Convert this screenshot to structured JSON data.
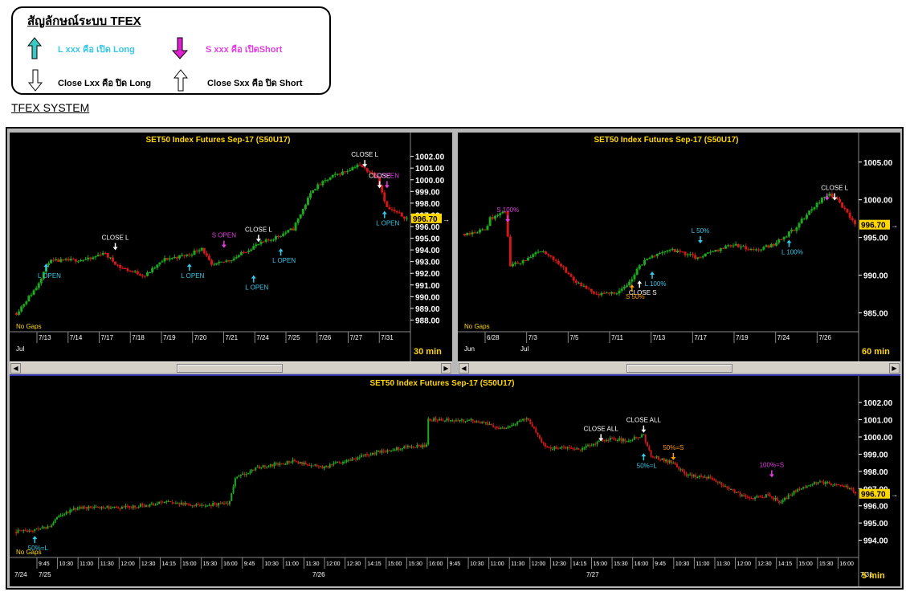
{
  "legend": {
    "title": "สัญลักษณ์ระบบ TFEX",
    "long_open": "L xxx คือ เปิด Long",
    "short_open": "S xxx คือ เปิดShort",
    "long_close": "Close Lxx คือ ปิด Long",
    "short_close": "Close Sxx คือ ปิด Short",
    "icons": [
      "arrow-up-teal-icon",
      "arrow-down-magenta-icon",
      "arrow-down-outline-icon",
      "arrow-up-outline-icon"
    ]
  },
  "system_title": "TFEX SYSTEM",
  "colors": {
    "up": "#1ea81e",
    "down": "#d01818",
    "title": "#ffd700",
    "axis": "#ffffff",
    "long": "#35c8e8",
    "short": "#e040e0",
    "close": "#ffffff",
    "half": "#ff9900",
    "cur": "#ffd700"
  },
  "chart_data": [
    {
      "type": "candlestick",
      "title": "SET50  Index  Futures  Sep-17  (S50U17)",
      "timeframe": "30  min",
      "gaps_label": "No Gaps",
      "ylim": [
        987.0,
        1002.8
      ],
      "yticks": [
        "1002.00",
        "1001.00",
        "1000.00",
        "999.00",
        "998.00",
        "997.00",
        "996.00",
        "995.00",
        "994.00",
        "993.00",
        "992.00",
        "991.00",
        "990.00",
        "989.00",
        "988.00"
      ],
      "current_price": "996.70",
      "x_labels": [
        "7/13",
        "7/14",
        "7/17",
        "7/18",
        "7/19",
        "7/20",
        "7/21",
        "7/24",
        "7/25",
        "7/26",
        "7/27",
        "7/31"
      ],
      "x_sub_labels": [
        "Jul"
      ],
      "anchors": [
        [
          0,
          988.6
        ],
        [
          8,
          990.8
        ],
        [
          13,
          993.0
        ],
        [
          30,
          993.2
        ],
        [
          35,
          993.8
        ],
        [
          42,
          992.5
        ],
        [
          52,
          991.8
        ],
        [
          60,
          993.2
        ],
        [
          70,
          993.6
        ],
        [
          75,
          994.2
        ],
        [
          79,
          992.6
        ],
        [
          88,
          993.3
        ],
        [
          96,
          994.3
        ],
        [
          104,
          995.0
        ],
        [
          112,
          995.8
        ],
        [
          120,
          999.2
        ],
        [
          128,
          1000.3
        ],
        [
          134,
          1000.8
        ],
        [
          138,
          1001.3
        ],
        [
          146,
          1000.3
        ],
        [
          150,
          997.6
        ],
        [
          158,
          996.7
        ]
      ],
      "signals": [
        {
          "text": "L  OPEN",
          "kind": "long",
          "x": 12,
          "price": 992.9,
          "pos": "below"
        },
        {
          "text": "CLOSE  L",
          "kind": "close",
          "x": 40,
          "price": 993.9,
          "pos": "above"
        },
        {
          "text": "L  OPEN",
          "kind": "long",
          "x": 70,
          "price": 992.9,
          "pos": "below"
        },
        {
          "text": "S  OPEN",
          "kind": "short",
          "x": 84,
          "price": 994.1,
          "pos": "above"
        },
        {
          "text": "CLOSE  L",
          "kind": "close",
          "x": 98,
          "price": 994.6,
          "pos": "above"
        },
        {
          "text": "L  OPEN",
          "kind": "long",
          "x": 96,
          "price": 991.9,
          "pos": "below"
        },
        {
          "text": "L  OPEN",
          "kind": "long",
          "x": 107,
          "price": 994.2,
          "pos": "below"
        },
        {
          "text": "CLOSE  L",
          "kind": "close",
          "x": 141,
          "price": 1001.0,
          "pos": "above"
        },
        {
          "text": "CLOSE",
          "kind": "close",
          "x": 147,
          "price": 999.2,
          "pos": "above"
        },
        {
          "text": "S  OPEN",
          "kind": "short",
          "x": 150,
          "price": 999.2,
          "pos": "above"
        },
        {
          "text": "L  OPEN",
          "kind": "long",
          "x": 149,
          "price": 997.4,
          "pos": "below"
        }
      ]
    },
    {
      "type": "candlestick",
      "title": "SET50  Index  Futures  Sep-17  (S50U17)",
      "timeframe": "60  min",
      "gaps_label": "No Gaps",
      "ylim": [
        982.5,
        1007.0
      ],
      "yticks": [
        "1005.00",
        "1000.00",
        "995.00",
        "990.00",
        "985.00"
      ],
      "current_price": "996.70",
      "x_labels": [
        "6/28",
        "7/3",
        "7/5",
        "7/11",
        "7/13",
        "7/17",
        "7/19",
        "7/24",
        "7/26"
      ],
      "x_sub_labels": [
        "Jun",
        "Jul"
      ],
      "anchors": [
        [
          0,
          995.5
        ],
        [
          8,
          996.0
        ],
        [
          10,
          997.5
        ],
        [
          16,
          998.5
        ],
        [
          18,
          991.3
        ],
        [
          24,
          992.0
        ],
        [
          30,
          993.2
        ],
        [
          36,
          992.0
        ],
        [
          44,
          989.0
        ],
        [
          52,
          987.3
        ],
        [
          60,
          987.8
        ],
        [
          64,
          988.5
        ],
        [
          68,
          990.8
        ],
        [
          72,
          992.2
        ],
        [
          80,
          993.4
        ],
        [
          86,
          993.0
        ],
        [
          92,
          992.2
        ],
        [
          98,
          993.2
        ],
        [
          106,
          994.1
        ],
        [
          114,
          993.2
        ],
        [
          122,
          994.1
        ],
        [
          130,
          996.1
        ],
        [
          138,
          999.2
        ],
        [
          144,
          1000.9
        ],
        [
          148,
          999.5
        ],
        [
          154,
          996.7
        ]
      ],
      "signals": [
        {
          "text": "S  100%",
          "kind": "short",
          "x": 17,
          "price": 996.9,
          "pos": "above"
        },
        {
          "text": "CLOSE  S",
          "kind": "close",
          "x": 69,
          "price": 989.4,
          "pos": "below"
        },
        {
          "text": "S  50%",
          "kind": "half",
          "x": 66,
          "price": 988.9,
          "pos": "below"
        },
        {
          "text": "L  100%",
          "kind": "long",
          "x": 74,
          "price": 990.6,
          "pos": "below"
        },
        {
          "text": "L  50%",
          "kind": "long",
          "x": 93,
          "price": 994.1,
          "pos": "above"
        },
        {
          "text": "L  100%",
          "kind": "long",
          "x": 128,
          "price": 994.8,
          "pos": "below"
        },
        {
          "text": "CLOSE  L",
          "kind": "close",
          "x": 146,
          "price": 999.8,
          "pos": "above"
        },
        {
          "text": "",
          "kind": "short",
          "x": 143,
          "price": 999.8,
          "pos": "above"
        }
      ]
    },
    {
      "type": "candlestick",
      "title": "SET50  Index  Futures  Sep-17  (S50U17)",
      "timeframe": "5  min",
      "gaps_label": "No Gaps",
      "ylim": [
        993.0,
        1002.8
      ],
      "yticks": [
        "1002.00",
        "1001.00",
        "1000.00",
        "999.00",
        "998.00",
        "997.00",
        "996.00",
        "995.00",
        "994.00"
      ],
      "current_price": "996.70",
      "x_labels": [
        "9:45",
        "10:30",
        "11:00",
        "11:30",
        "12:00",
        "12:30",
        "14:15",
        "15:00",
        "15:30",
        "16:00",
        "9:45",
        "10:30",
        "11:00",
        "11:30",
        "12:00",
        "12:30",
        "14:15",
        "15:00",
        "15:30",
        "16:00",
        "9:45",
        "10:30",
        "11:00",
        "11:30",
        "12:00",
        "12:30",
        "14:15",
        "15:00",
        "15:30",
        "16:00",
        "9:45",
        "10:30",
        "11:00",
        "11:30",
        "12:00",
        "12:30",
        "14:15",
        "15:00",
        "15:30",
        "16:00"
      ],
      "x_sub_labels": [
        "7/24",
        "7/25",
        "7/26",
        "7/27",
        "7/31"
      ],
      "anchors": [
        [
          0,
          994.5
        ],
        [
          10,
          994.6
        ],
        [
          18,
          994.8
        ],
        [
          24,
          995.5
        ],
        [
          34,
          995.9
        ],
        [
          60,
          995.9
        ],
        [
          80,
          996.2
        ],
        [
          100,
          996.0
        ],
        [
          115,
          996.2
        ],
        [
          118,
          997.6
        ],
        [
          130,
          998.2
        ],
        [
          150,
          998.6
        ],
        [
          165,
          998.2
        ],
        [
          190,
          999.0
        ],
        [
          210,
          999.4
        ],
        [
          221,
          999.5
        ],
        [
          222,
          1001.0
        ],
        [
          245,
          1001.0
        ],
        [
          262,
          1000.5
        ],
        [
          275,
          1001.1
        ],
        [
          285,
          999.4
        ],
        [
          305,
          999.3
        ],
        [
          318,
          999.9
        ],
        [
          330,
          999.8
        ],
        [
          338,
          1000.1
        ],
        [
          342,
          998.9
        ],
        [
          354,
          998.5
        ],
        [
          360,
          997.8
        ],
        [
          375,
          997.6
        ],
        [
          385,
          996.9
        ],
        [
          395,
          996.4
        ],
        [
          405,
          996.6
        ],
        [
          412,
          996.2
        ],
        [
          420,
          996.9
        ],
        [
          430,
          997.4
        ],
        [
          445,
          997.2
        ],
        [
          452,
          996.8
        ]
      ],
      "signals": [
        {
          "text": "50%=L",
          "kind": "long",
          "x": 10,
          "price": 994.3,
          "pos": "below"
        },
        {
          "text": "CLOSE  ALL",
          "kind": "close",
          "x": 315,
          "price": 999.7,
          "pos": "above"
        },
        {
          "text": "CLOSE  ALL",
          "kind": "close",
          "x": 338,
          "price": 1000.2,
          "pos": "above"
        },
        {
          "text": "50%=L",
          "kind": "long",
          "x": 338,
          "price": 999.1,
          "pos": "below"
        },
        {
          "text": "50%=S",
          "kind": "half",
          "x": 354,
          "price": 998.6,
          "pos": "above"
        },
        {
          "text": "100%=S",
          "kind": "short",
          "x": 407,
          "price": 997.6,
          "pos": "above"
        }
      ]
    }
  ]
}
